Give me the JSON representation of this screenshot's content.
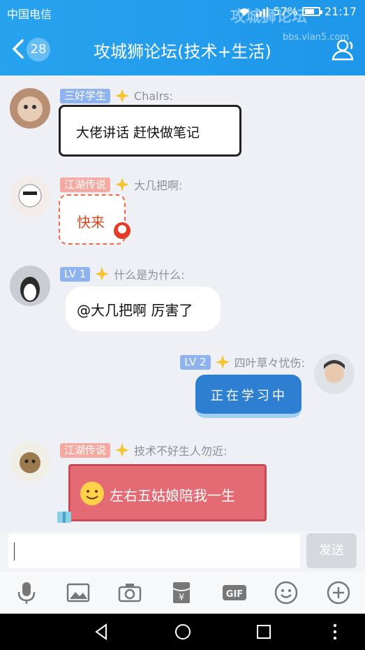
{
  "status": {
    "carrier": "中国电信",
    "battery": "57%",
    "time": "21:17"
  },
  "watermark": {
    "name": "攻城狮论坛",
    "url": "bbs.vlan5.com"
  },
  "header": {
    "unread_count": "28",
    "title": "攻城狮论坛(技术+生活)"
  },
  "messages": [
    {
      "tag": "三好学生",
      "sender": "Chalrs:",
      "text": "大佬讲话 赶快做笔记"
    },
    {
      "tag": "江湖传说",
      "sender": "大几把啊:",
      "text": "快来"
    },
    {
      "tag": "LV 1",
      "sender": "什么是为什么:",
      "text": "@大几把啊 厉害了"
    },
    {
      "tag": "LV 2",
      "sender": "四叶草々忧伤:",
      "text": "正在学习中"
    },
    {
      "tag": "江湖传说",
      "sender": "技术不好生人勿近:",
      "text": "左右五姑娘陪我一生"
    }
  ],
  "input": {
    "value": "",
    "send_label": "发送"
  },
  "colors": {
    "header": "#1e96ea",
    "accent_blue": "#8fb3ee",
    "accent_red": "#f5a9a0",
    "bubble_pink": "#e9727a"
  }
}
